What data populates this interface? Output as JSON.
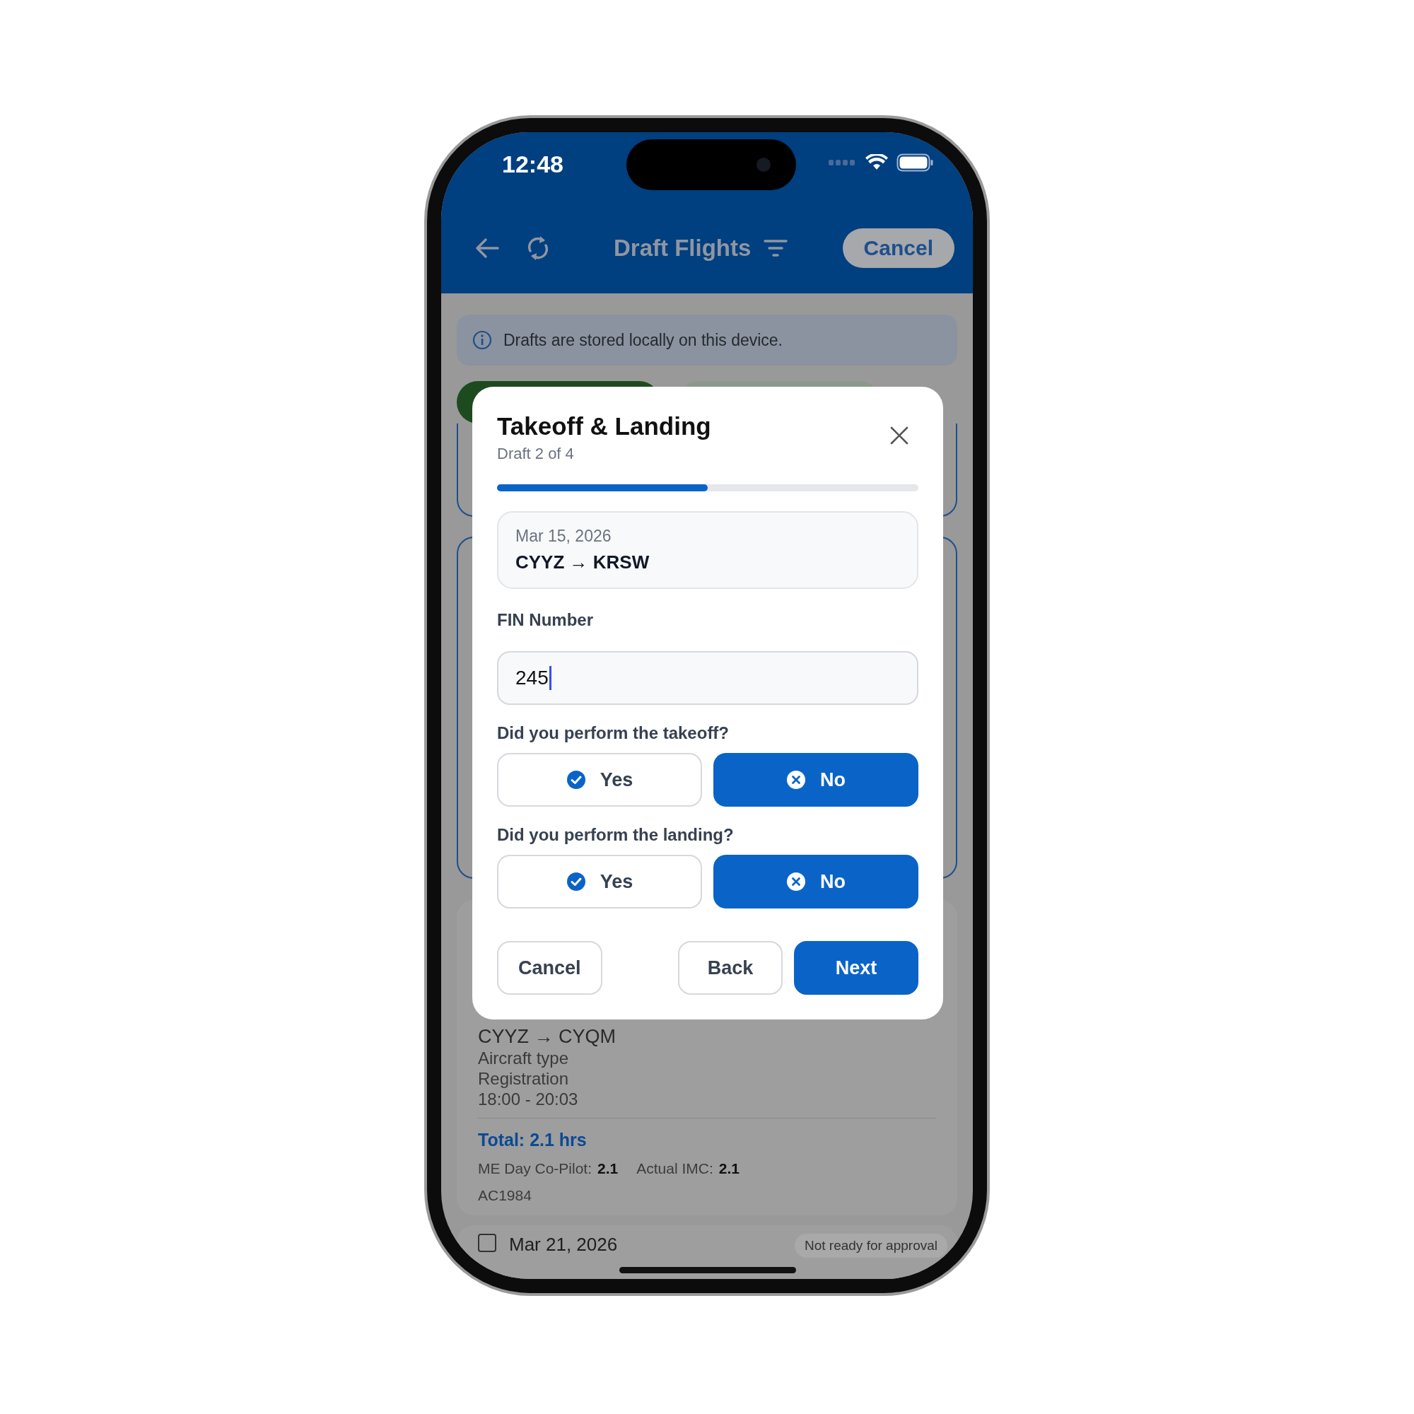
{
  "status_bar": {
    "time": "12:48"
  },
  "header": {
    "title": "Draft Flights",
    "cancel_label": "Cancel"
  },
  "info_banner": {
    "text": "Drafts are stored locally on this device."
  },
  "flight_card": {
    "route": "CYYZ → CYQM",
    "lines": [
      "Aircraft type",
      "Registration",
      "18:00 - 20:03"
    ],
    "total": "Total: 2.1 hrs",
    "stats": [
      {
        "label": "ME Day Co-Pilot:",
        "value": "2.1"
      },
      {
        "label": "Actual IMC:",
        "value": "2.1"
      }
    ],
    "flight_number": "AC1984"
  },
  "next_card": {
    "date": "Mar 21, 2026",
    "checked": false,
    "status": "Not ready for approval"
  },
  "dialog": {
    "title": "Takeoff & Landing",
    "subtitle": "Draft 2 of 4",
    "progress": {
      "level": 0.5
    },
    "summary": {
      "date": "Mar 15, 2026",
      "route": "CYYZ → KRSW"
    },
    "fin": {
      "label": "FIN Number",
      "value": "245"
    },
    "questions": [
      {
        "text": "Did you perform the takeoff?",
        "options": [
          {
            "label": "Yes",
            "kind": "yes",
            "selected": false
          },
          {
            "label": "No",
            "kind": "no",
            "selected": true
          }
        ]
      },
      {
        "text": "Did you perform the landing?",
        "options": [
          {
            "label": "Yes",
            "kind": "yes",
            "selected": false
          },
          {
            "label": "No",
            "kind": "no",
            "selected": true
          }
        ]
      }
    ],
    "actions": [
      {
        "label": "Cancel",
        "kind": "secondary"
      },
      {
        "label": "Back",
        "kind": "secondary"
      },
      {
        "label": "Next",
        "kind": "primary"
      }
    ]
  }
}
